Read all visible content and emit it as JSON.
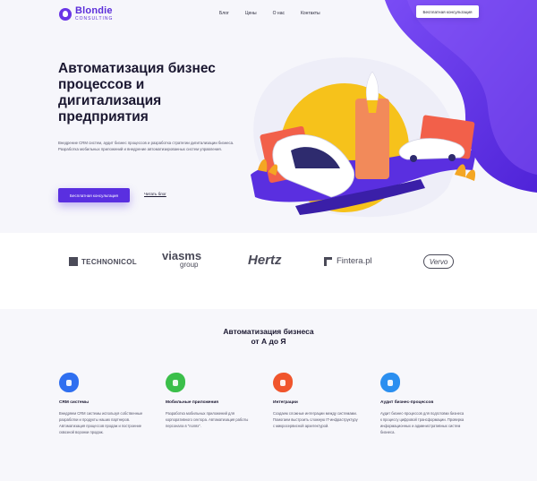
{
  "header": {
    "logo_name": "Blondie",
    "logo_sub": "CONSULTING",
    "nav": [
      "Блог",
      "Цены",
      "О нас",
      "Контакты"
    ],
    "cta_label": "Бесплатная консультация"
  },
  "hero": {
    "title": "Автоматизация бизнес процессов и дигитализация предприятия",
    "desc_lines": [
      "Внедрение CRM систем, аудит бизнес процессов и разработка стратегии дигитализации бизнеса.",
      "Разработка мобильных приложений и внедрение автоматизированных систем управления."
    ],
    "primary_button": "Бесплатная консультация",
    "secondary_link": "Читать блог"
  },
  "partners": {
    "technonicol": "TECHNONICOL",
    "viasms_top": "viasms",
    "viasms_bottom": "group",
    "hertz": "Hertz",
    "fintera": "Fintera.pl",
    "vervo": "Vervo"
  },
  "section": {
    "title_line1": "Автоматизация бизнеса",
    "title_line2": "от А до Я"
  },
  "features": [
    {
      "title": "CRM системы",
      "text": "Внедряем CRM системы используя собственные разработки и продукты наших партнеров. Автоматизация процессов продаж и построение сквозной воронки продаж.",
      "icon": "crm-icon",
      "color": "#2f6ff0"
    },
    {
      "title": "Мобильные приложения",
      "text": "Разработка мобильных приложений для корпоративного сектора. Автоматизация работы персонала в \"полях\".",
      "icon": "mobile-icon",
      "color": "#3bbf4a"
    },
    {
      "title": "Интеграции",
      "text": "Создаем сложные интеграции между системами. Помогаем выстроить сложную IT-инфраструктуру с микросервисной архитектурой.",
      "icon": "integration-icon",
      "color": "#f0552c"
    },
    {
      "title": "Аудит бизнес-процессов",
      "text": "Аудит бизнес-процессов для подготовки бизнеса к процессу цифровой трансформации. Проверка информационных и административных систем бизнеса.",
      "icon": "audit-icon",
      "color": "#2b8ff0"
    }
  ],
  "colors": {
    "accent": "#5a2fe0",
    "blob": "#6b3cf0"
  }
}
